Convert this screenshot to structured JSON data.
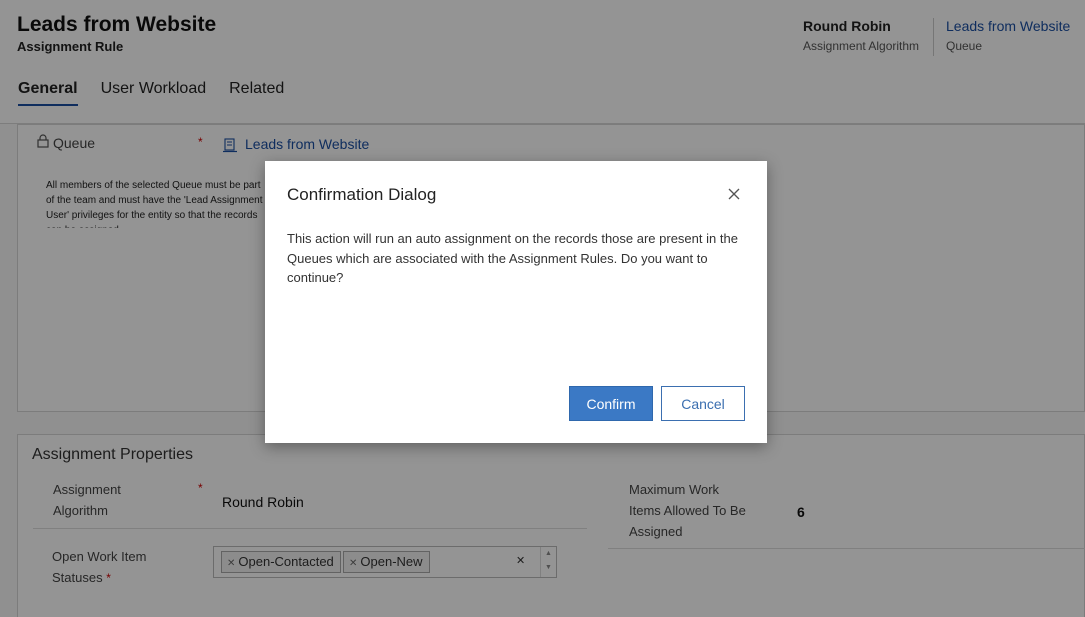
{
  "header": {
    "title": "Leads from Website",
    "subtitle": "Assignment Rule",
    "fields": [
      {
        "value": "Round Robin",
        "label": "Assignment Algorithm"
      },
      {
        "value": "Leads from Website",
        "label": "Queue"
      }
    ]
  },
  "tabs": [
    {
      "label": "General",
      "active": true
    },
    {
      "label": "User Workload",
      "active": false
    },
    {
      "label": "Related",
      "active": false
    }
  ],
  "general": {
    "queue_label": "Queue",
    "required_mark": "*",
    "queue_value": "Leads from Website",
    "info_text": "All members of the selected Queue must be part of the team and must have the 'Lead Assignment User' privileges for the entity so that the records can be assigned."
  },
  "assignment_properties": {
    "title": "Assignment Properties",
    "algorithm_label_line1": "Assignment",
    "algorithm_label_line2": "Algorithm",
    "algorithm_value": "Round Robin",
    "statuses_label_line1": "Open Work Item",
    "statuses_label_line2": "Statuses",
    "statuses": [
      "Open-Contacted",
      "Open-New"
    ],
    "max_label_line1": "Maximum Work",
    "max_label_line2": "Items Allowed To Be",
    "max_label_line3": "Assigned",
    "max_value": "6"
  },
  "dialog": {
    "title": "Confirmation Dialog",
    "message": "This action will run an auto assignment on the records those are present in the Queues which are associated with the Assignment Rules. Do you want to continue?",
    "confirm_label": "Confirm",
    "cancel_label": "Cancel"
  },
  "icons": {
    "lock": "lock-icon",
    "queue": "queue-icon",
    "close": "close-icon",
    "chip_remove": "x-icon",
    "clear": "x-icon",
    "spinner": "up-down-arrows-icon"
  },
  "colors": {
    "accent": "#1a4fa3",
    "confirm_button": "#3b79c5",
    "required": "#cc0000"
  }
}
